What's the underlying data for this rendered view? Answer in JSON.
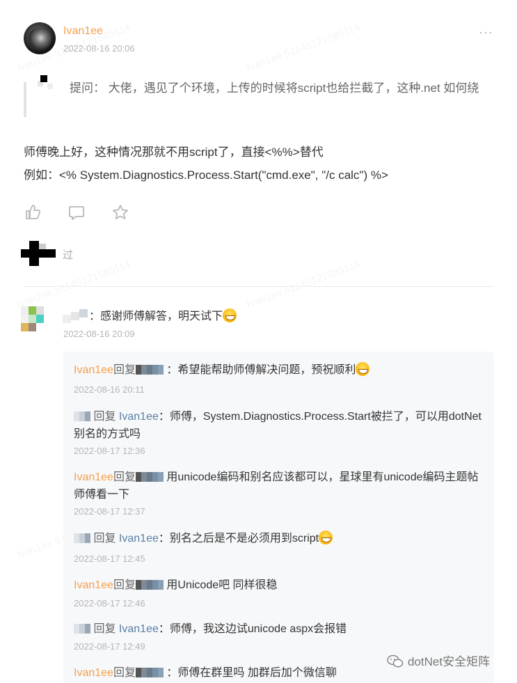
{
  "post": {
    "author": "Ivan1ee",
    "time": "2022-08-16 20:06",
    "more_label": "···",
    "quote": "提问： 大佬，遇见了个环境，上传的时候将script也给拦截了，这种.net 如何绕",
    "body_line1": "师傅晚上好，这种情况那就不用script了，直接<%%>替代",
    "body_line2": "例如：<% System.Diagnostics.Process.Start(\"cmd.exe\", \"/c calc\") %>",
    "actions": [
      "like-icon",
      "comment-icon",
      "star-icon"
    ],
    "liked_suffix": "过"
  },
  "comment": {
    "text": "：感谢师傅解答，明天试下",
    "time": "2022-08-16 20:09"
  },
  "replies": [
    {
      "name": "Ivan1ee",
      "reply_word": "回复",
      "target": "",
      "text": "：希望能帮助师傅解决问题，预祝顺利",
      "emoji": "grin",
      "time": "2022-08-16 20:11"
    },
    {
      "name": "",
      "reply_word": "回复",
      "target": "Ivan1ee",
      "text": "：师傅，System.Diagnostics.Process.Start被拦了，可以用dotNet别名的方式吗",
      "emoji": "",
      "time": "2022-08-17 12:36"
    },
    {
      "name": "Ivan1ee",
      "reply_word": "回复",
      "target": "",
      "text": "用unicode编码和别名应该都可以，星球里有unicode编码主题帖 师傅看一下",
      "emoji": "",
      "time": "2022-08-17 12:37"
    },
    {
      "name": "",
      "reply_word": "回复",
      "target": "Ivan1ee",
      "text": "：别名之后是不是必须用到script",
      "emoji": "sweat",
      "time": "2022-08-17 12:45"
    },
    {
      "name": "Ivan1ee",
      "reply_word": "回复",
      "target": "",
      "text": "用Unicode吧 同样很稳",
      "emoji": "",
      "time": "2022-08-17 12:46"
    },
    {
      "name": "",
      "reply_word": "回复",
      "target": "Ivan1ee",
      "text": "：师傅，我这边试unicode aspx会报错",
      "emoji": "",
      "time": "2022-08-17 12:49"
    },
    {
      "name": "Ivan1ee",
      "reply_word": "回复",
      "target": "",
      "text": "：师傅在群里吗 加群后加个微信聊",
      "emoji": "",
      "time": ""
    }
  ],
  "watermark_text": "Ivan1ee 51145121585114",
  "brand": {
    "icon": "wechat-icon",
    "text": "dotNet安全矩阵"
  },
  "colors": {
    "author": "#f5a04a",
    "reply_target": "#5a7fa6",
    "time": "#b5b5b5"
  }
}
